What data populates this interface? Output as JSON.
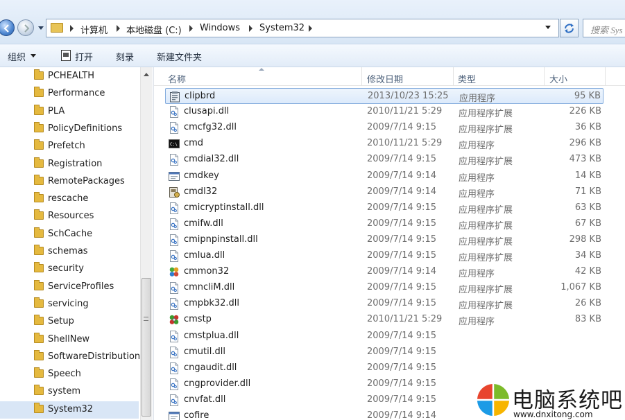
{
  "address_bar": {
    "breadcrumbs": [
      "计算机",
      "本地磁盘 (C:)",
      "Windows",
      "System32"
    ],
    "search_placeholder": "搜索 Sys"
  },
  "toolbar": {
    "organize": "组织",
    "open": "打开",
    "burn": "刻录",
    "new_folder": "新建文件夹"
  },
  "nav_items": [
    {
      "label": "PCHEALTH"
    },
    {
      "label": "Performance"
    },
    {
      "label": "PLA"
    },
    {
      "label": "PolicyDefinitions"
    },
    {
      "label": "Prefetch"
    },
    {
      "label": "Registration"
    },
    {
      "label": "RemotePackages"
    },
    {
      "label": "rescache"
    },
    {
      "label": "Resources"
    },
    {
      "label": "SchCache"
    },
    {
      "label": "schemas"
    },
    {
      "label": "security"
    },
    {
      "label": "ServiceProfiles"
    },
    {
      "label": "servicing"
    },
    {
      "label": "Setup"
    },
    {
      "label": "ShellNew"
    },
    {
      "label": "SoftwareDistribution"
    },
    {
      "label": "Speech"
    },
    {
      "label": "system"
    },
    {
      "label": "System32",
      "selected": true
    }
  ],
  "columns": {
    "name": "名称",
    "modified": "修改日期",
    "type": "类型",
    "size": "大小"
  },
  "files": [
    {
      "name": "clipbrd",
      "date": "2013/10/23 15:25",
      "type": "应用程序",
      "size": "95 KB",
      "icon": "clipboard-icon",
      "selected": true
    },
    {
      "name": "clusapi.dll",
      "date": "2010/11/21 5:29",
      "type": "应用程序扩展",
      "size": "226 KB",
      "icon": "dll-file-icon"
    },
    {
      "name": "cmcfg32.dll",
      "date": "2009/7/14 9:15",
      "type": "应用程序扩展",
      "size": "36 KB",
      "icon": "dll-file-icon"
    },
    {
      "name": "cmd",
      "date": "2010/11/21 5:29",
      "type": "应用程序",
      "size": "296 KB",
      "icon": "cmd-icon"
    },
    {
      "name": "cmdial32.dll",
      "date": "2009/7/14 9:15",
      "type": "应用程序扩展",
      "size": "473 KB",
      "icon": "dll-file-icon"
    },
    {
      "name": "cmdkey",
      "date": "2009/7/14 9:14",
      "type": "应用程序",
      "size": "14 KB",
      "icon": "app-window-icon"
    },
    {
      "name": "cmdl32",
      "date": "2009/7/14 9:14",
      "type": "应用程序",
      "size": "71 KB",
      "icon": "cmdl-icon"
    },
    {
      "name": "cmicryptinstall.dll",
      "date": "2009/7/14 9:15",
      "type": "应用程序扩展",
      "size": "63 KB",
      "icon": "dll-file-icon"
    },
    {
      "name": "cmifw.dll",
      "date": "2009/7/14 9:15",
      "type": "应用程序扩展",
      "size": "67 KB",
      "icon": "dll-file-icon"
    },
    {
      "name": "cmipnpinstall.dll",
      "date": "2009/7/14 9:15",
      "type": "应用程序扩展",
      "size": "298 KB",
      "icon": "dll-file-icon"
    },
    {
      "name": "cmlua.dll",
      "date": "2009/7/14 9:15",
      "type": "应用程序扩展",
      "size": "34 KB",
      "icon": "dll-file-icon"
    },
    {
      "name": "cmmon32",
      "date": "2009/7/14 9:14",
      "type": "应用程序",
      "size": "42 KB",
      "icon": "cmmon-icon"
    },
    {
      "name": "cmncliM.dll",
      "date": "2009/7/14 9:15",
      "type": "应用程序扩展",
      "size": "1,067 KB",
      "icon": "dll-file-icon"
    },
    {
      "name": "cmpbk32.dll",
      "date": "2009/7/14 9:15",
      "type": "应用程序扩展",
      "size": "26 KB",
      "icon": "dll-file-icon"
    },
    {
      "name": "cmstp",
      "date": "2010/11/21 5:29",
      "type": "应用程序",
      "size": "83 KB",
      "icon": "cmstp-icon"
    },
    {
      "name": "cmstplua.dll",
      "date": "2009/7/14 9:15",
      "type": "",
      "size": "",
      "icon": "dll-file-icon"
    },
    {
      "name": "cmutil.dll",
      "date": "2009/7/14 9:15",
      "type": "",
      "size": "",
      "icon": "dll-file-icon"
    },
    {
      "name": "cngaudit.dll",
      "date": "2009/7/14 9:15",
      "type": "",
      "size": "",
      "icon": "dll-file-icon"
    },
    {
      "name": "cngprovider.dll",
      "date": "2009/7/14 9:15",
      "type": "",
      "size": "",
      "icon": "dll-file-icon"
    },
    {
      "name": "cnvfat.dll",
      "date": "2009/7/14 9:15",
      "type": "",
      "size": "",
      "icon": "dll-file-icon"
    },
    {
      "name": "cofire",
      "date": "2009/7/14 9:14",
      "type": "",
      "size": "",
      "icon": "app-window-icon"
    }
  ],
  "watermark": {
    "title": "电脑系统吧",
    "url": "www.dnxitong.com"
  },
  "colors": {
    "selection_bg": "#d9e6f6",
    "selection_border": "#84acdd",
    "header_text": "#4c607a",
    "detail_text": "#6d6d6d"
  }
}
